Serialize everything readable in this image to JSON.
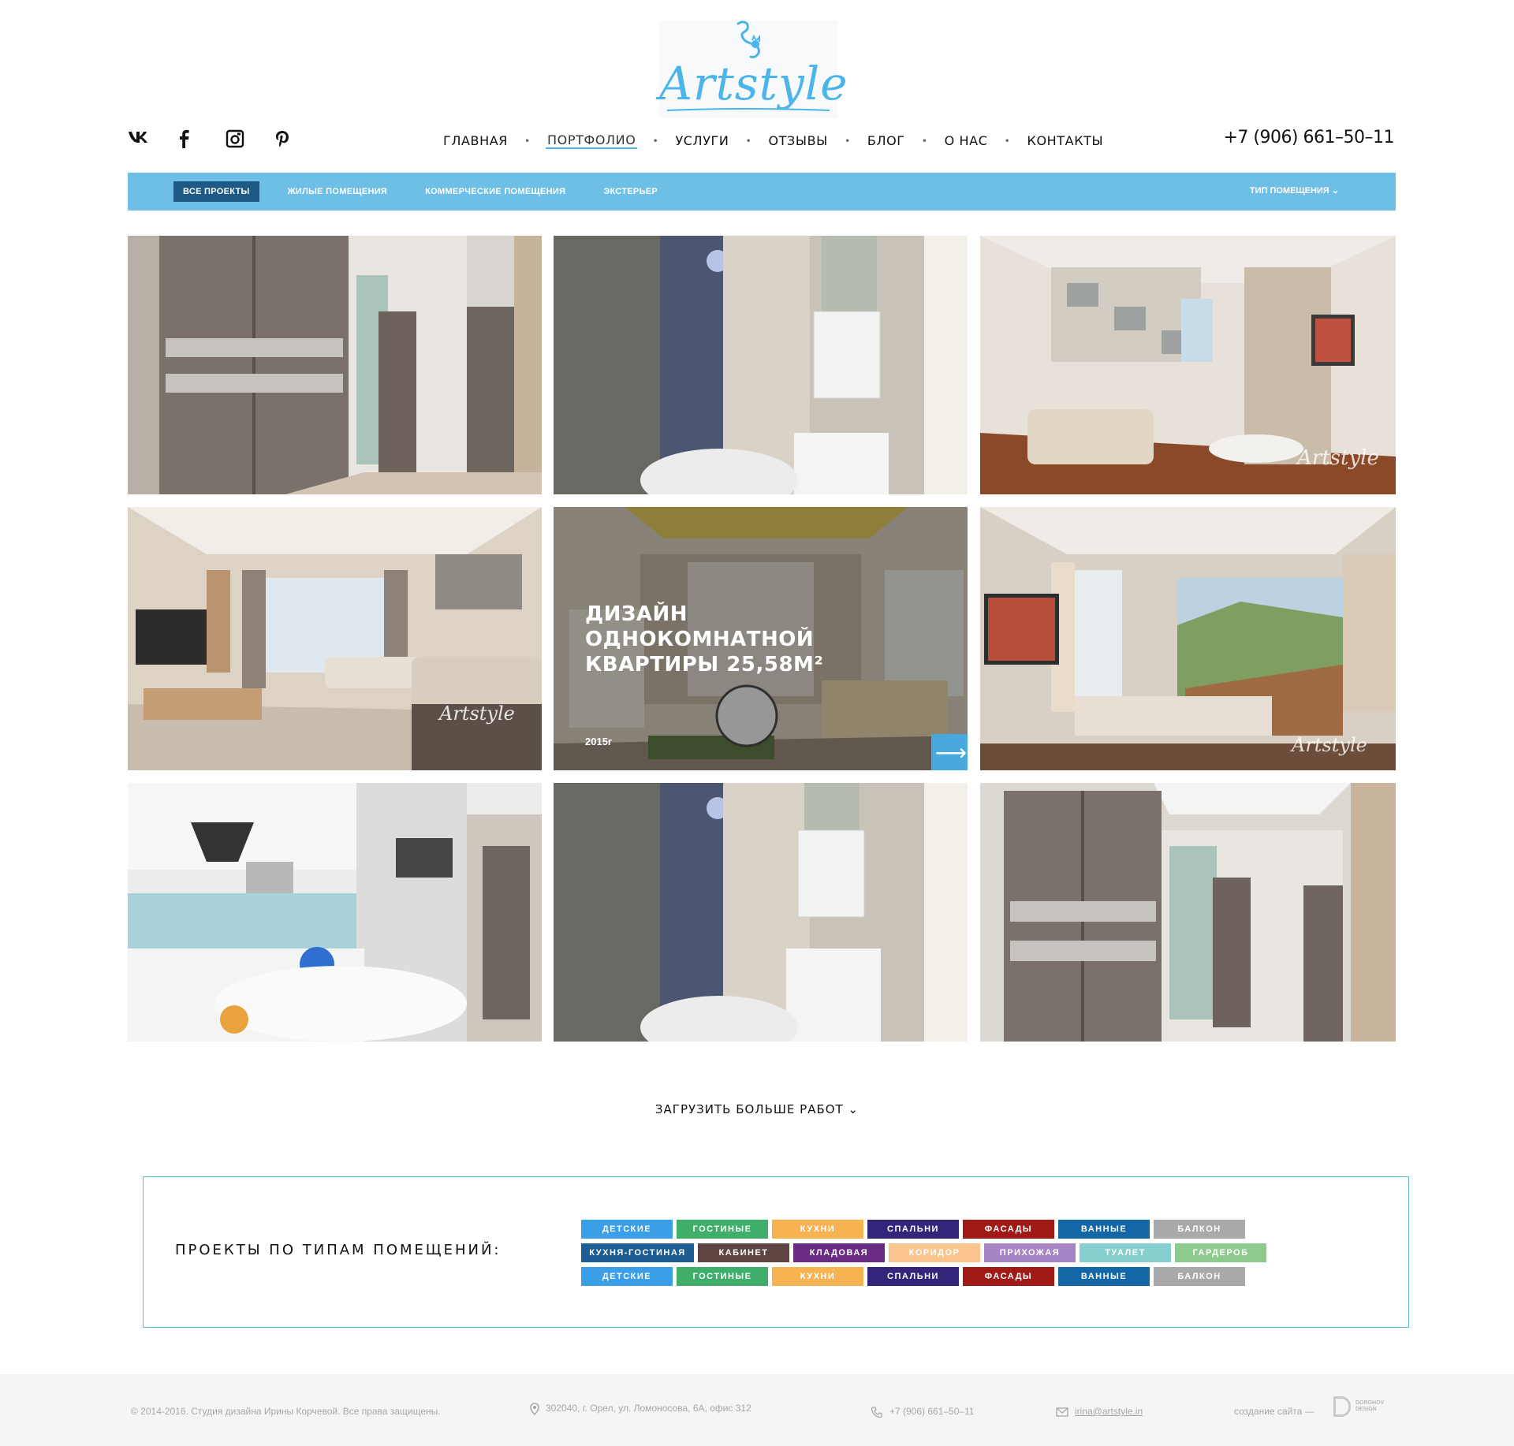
{
  "brand": {
    "logo_text": "Artstyle",
    "accent": "#4bb4e8"
  },
  "social": [
    {
      "icon": "vk-icon",
      "glyph": "vk"
    },
    {
      "icon": "facebook-icon",
      "glyph": "f"
    },
    {
      "icon": "instagram-icon",
      "glyph": ""
    },
    {
      "icon": "pinterest-icon",
      "glyph": ""
    }
  ],
  "nav": {
    "items": [
      "ГЛАВНАЯ",
      "ПОРТФОЛИО",
      "УСЛУГИ",
      "ОТЗЫВЫ",
      "БЛОГ",
      "О НАС",
      "КОНТАКТЫ"
    ],
    "active_index": 1,
    "separator": "•"
  },
  "phone": "+7 (906) 661–50–11",
  "filters": {
    "items": [
      "ВСЕ ПРОЕКТЫ",
      "ЖИЛЫЕ ПОМЕЩЕНИЯ",
      "КОММЕРЧЕСКИЕ ПОМЕЩЕНИЯ",
      "ЭКСТЕРЬЕР"
    ],
    "active_index": 0,
    "type_dropdown": "ТИП ПОМЕЩЕНИЯ ⌄",
    "bar_color": "#6dbfe6"
  },
  "gallery": {
    "watermark": "Artstyle",
    "featured": {
      "title_line1": "ДИЗАЙН",
      "title_line2": "ОДНОКОМНАТНОЙ",
      "title_line3": "КВАРТИРЫ 25,58М²",
      "year": "2015г",
      "arrow": "⟶"
    }
  },
  "load_more": "ЗАГРУЗИТЬ БОЛЬШЕ РАБОТ ⌄",
  "room_types": {
    "title": "ПРОЕКТЫ ПО ТИПАМ ПОМЕЩЕНИЙ:",
    "rows": [
      [
        {
          "label": "ДЕТСКИЕ",
          "color": "#3a9fe6"
        },
        {
          "label": "ГОСТИНЫЕ",
          "color": "#3fae6a"
        },
        {
          "label": "КУХНИ",
          "color": "#f7b252"
        },
        {
          "label": "СПАЛЬНИ",
          "color": "#33257a"
        },
        {
          "label": "ФАСАДЫ",
          "color": "#a01a17"
        },
        {
          "label": "ВАННЫЕ",
          "color": "#1467a7"
        },
        {
          "label": "БАЛКОН",
          "color": "#a9a9a9"
        }
      ],
      [
        {
          "label": "КУХНЯ-ГОСТИНАЯ",
          "color": "#1c5d93",
          "wide": true
        },
        {
          "label": "КАБИНЕТ",
          "color": "#5f4541"
        },
        {
          "label": "КЛАДОВАЯ",
          "color": "#6a2b83"
        },
        {
          "label": "КОРИДОР",
          "color": "#fbc48d"
        },
        {
          "label": "ПРИХОЖАЯ",
          "color": "#a784c3"
        },
        {
          "label": "ТУАЛЕТ",
          "color": "#86cfcf"
        },
        {
          "label": "ГАРДЕРОБ",
          "color": "#8fca8d"
        }
      ],
      [
        {
          "label": "ДЕТСКИЕ",
          "color": "#3a9fe6"
        },
        {
          "label": "ГОСТИНЫЕ",
          "color": "#3fae6a"
        },
        {
          "label": "КУХНИ",
          "color": "#f7b252"
        },
        {
          "label": "СПАЛЬНИ",
          "color": "#33257a"
        },
        {
          "label": "ФАСАДЫ",
          "color": "#a01a17"
        },
        {
          "label": "ВАННЫЕ",
          "color": "#1467a7"
        },
        {
          "label": "БАЛКОН",
          "color": "#a9a9a9"
        }
      ]
    ]
  },
  "footer": {
    "copyright": "© 2014-2016. Студия дизайна Ирины Корчевой. Все права защищены.",
    "address": "302040, г. Орел, ул. Ломоносова, 6А, офис 312",
    "phone": "+7 (906) 661–50–11",
    "email": "irina@artstyle.in",
    "credit": "создание сайта —",
    "credit_brand_1": "DOROHOV",
    "credit_brand_2": "DESIGN"
  }
}
